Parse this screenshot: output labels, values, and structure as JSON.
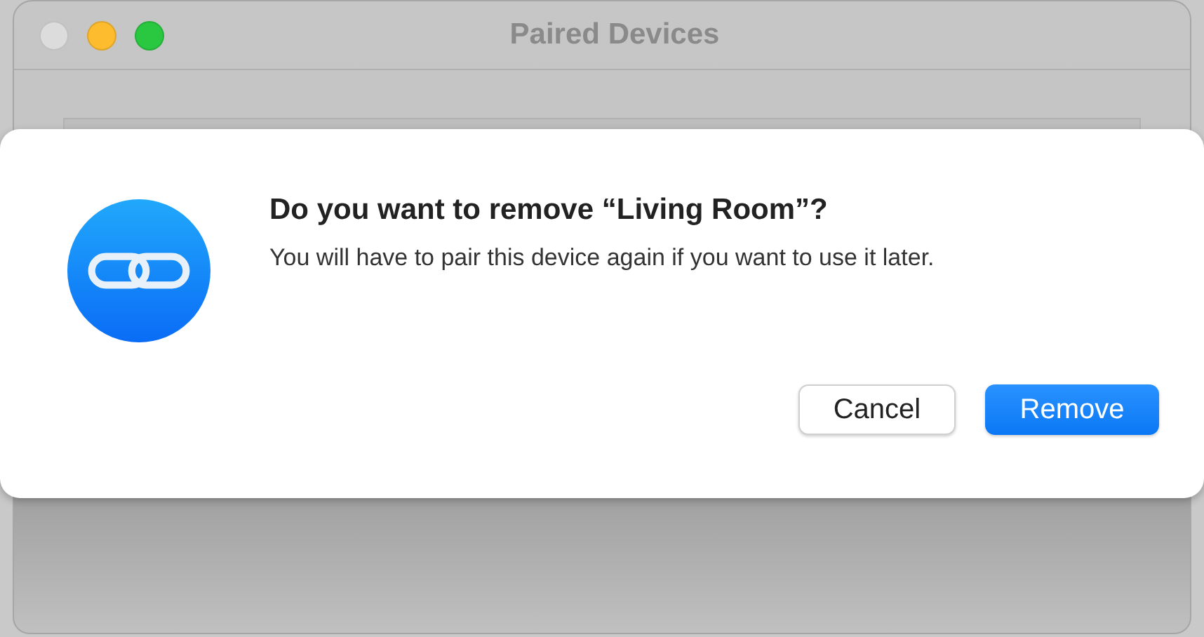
{
  "window": {
    "title": "Paired Devices"
  },
  "dialog": {
    "title": "Do you want to remove “Living Room”?",
    "message": "You will have to pair this device again if you want to use it later.",
    "buttons": [
      {
        "label": "Cancel",
        "primary": false
      },
      {
        "label": "Remove",
        "primary": true
      }
    ]
  }
}
